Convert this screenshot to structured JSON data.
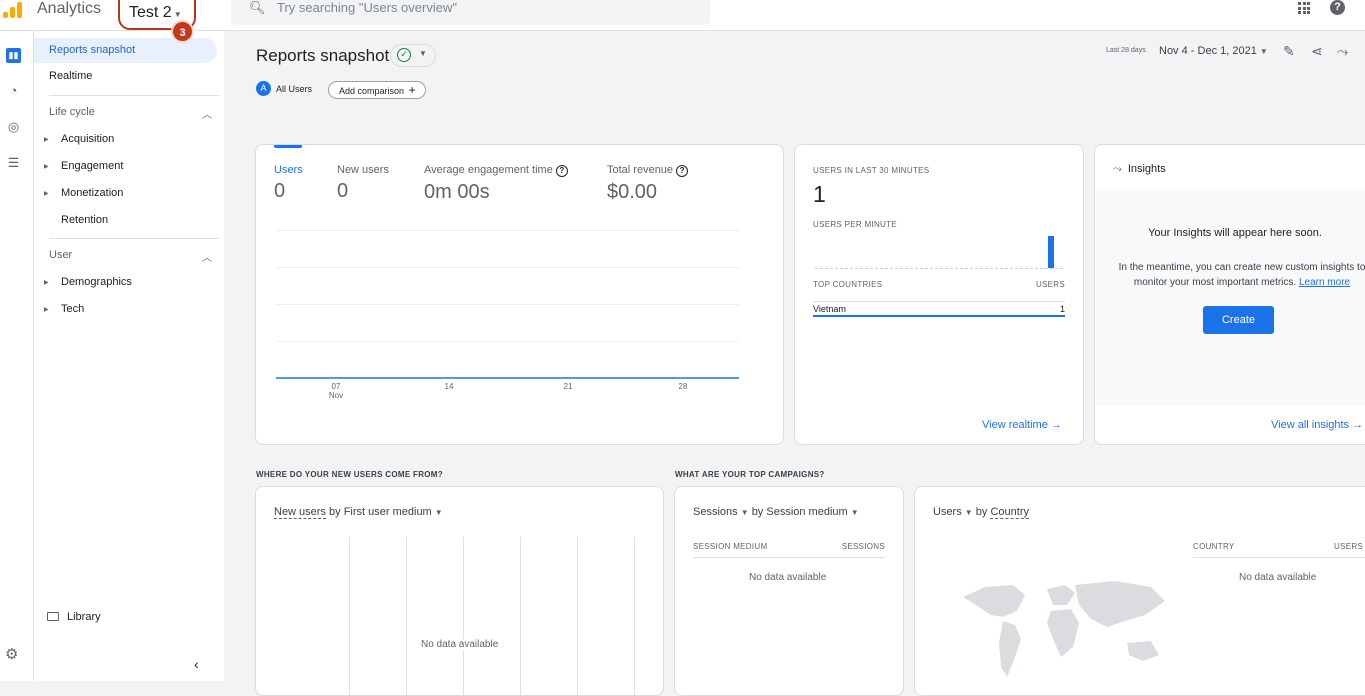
{
  "topbar": {
    "app_title": "Analytics",
    "account_name": "Test 2",
    "step_badge": "3",
    "search_placeholder": "Try searching \"Users overview\""
  },
  "nav": {
    "items": [
      {
        "label": "Reports snapshot",
        "active": true
      },
      {
        "label": "Realtime",
        "active": false
      }
    ],
    "lifecycle": {
      "label": "Life cycle",
      "items": [
        {
          "label": "Acquisition",
          "expandable": true
        },
        {
          "label": "Engagement",
          "expandable": true
        },
        {
          "label": "Monetization",
          "expandable": true
        },
        {
          "label": "Retention",
          "expandable": false
        }
      ]
    },
    "user": {
      "label": "User",
      "items": [
        {
          "label": "Demographics",
          "expandable": true
        },
        {
          "label": "Tech",
          "expandable": true
        }
      ]
    },
    "library_label": "Library"
  },
  "header": {
    "title": "Reports snapshot",
    "comparison_chip": "All Users",
    "comparison_avatar": "A",
    "add_comparison": "Add comparison",
    "date_label": "Last 28 days",
    "date_range": "Nov 4 - Dec 1, 2021"
  },
  "overview": {
    "metrics": [
      {
        "label": "Users",
        "value": "0",
        "selected": true,
        "help": false
      },
      {
        "label": "New users",
        "value": "0",
        "selected": false,
        "help": false
      },
      {
        "label": "Average engagement time",
        "value": "0m 00s",
        "selected": false,
        "help": true
      },
      {
        "label": "Total revenue",
        "value": "$0.00",
        "selected": false,
        "help": true
      }
    ],
    "x_ticks": [
      {
        "day": "07",
        "month": "Nov"
      },
      {
        "day": "14",
        "month": ""
      },
      {
        "day": "21",
        "month": ""
      },
      {
        "day": "28",
        "month": ""
      }
    ]
  },
  "chart_data": {
    "type": "line",
    "series": [
      {
        "name": "Users",
        "values": [
          0,
          0,
          0,
          0,
          0,
          0,
          0,
          0,
          0,
          0,
          0,
          0,
          0,
          0,
          0,
          0,
          0,
          0,
          0,
          0,
          0,
          0,
          0,
          0,
          0,
          0,
          0,
          0
        ]
      }
    ],
    "x_tick_labels": [
      "07 Nov",
      "14",
      "21",
      "28"
    ]
  },
  "realtime": {
    "title": "USERS IN LAST 30 MINUTES",
    "value": "1",
    "per_minute_label": "USERS PER MINUTE",
    "per_minute": [
      0,
      0,
      0,
      0,
      0,
      0,
      0,
      0,
      0,
      0,
      0,
      0,
      0,
      0,
      0,
      0,
      0,
      0,
      0,
      0,
      0,
      0,
      0,
      0,
      0,
      0,
      0,
      0,
      1,
      0
    ],
    "countries_label": "TOP COUNTRIES",
    "users_label": "USERS",
    "rows": [
      {
        "country": "Vietnam",
        "users": "1"
      }
    ],
    "view_link": "View realtime"
  },
  "insights": {
    "title": "Insights",
    "heading": "Your Insights will appear here soon.",
    "text": "In the meantime, you can create new custom insights to monitor your most important metrics.",
    "learn_more": "Learn more",
    "create": "Create",
    "view_all": "View all insights"
  },
  "sections": {
    "new_users_q": "WHERE DO YOUR NEW USERS COME FROM?",
    "campaigns_q": "WHAT ARE YOUR TOP CAMPAIGNS?"
  },
  "new_users_card": {
    "metric": "New users",
    "by": "by First user medium",
    "no_data": "No data available"
  },
  "campaigns_card": {
    "metric": "Sessions",
    "by": "by Session medium",
    "col1": "SESSION MEDIUM",
    "col2": "SESSIONS",
    "no_data": "No data available"
  },
  "country_card": {
    "metric": "Users",
    "by_prefix": "by",
    "by": "Country",
    "col1": "COUNTRY",
    "col2": "USERS",
    "no_data": "No data available"
  },
  "colors": {
    "accent": "#1a73e8",
    "badge": "#c0391b",
    "logo": "#f9ab00"
  }
}
